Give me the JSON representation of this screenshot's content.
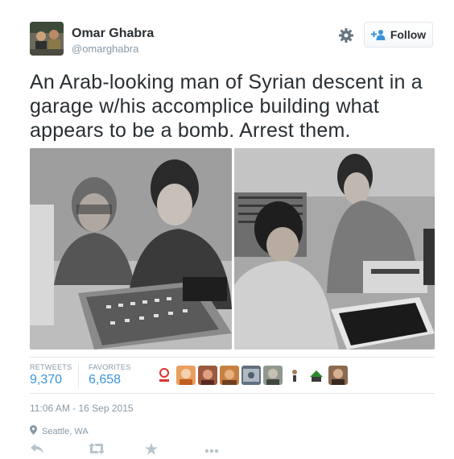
{
  "user": {
    "name": "Omar Ghabra",
    "handle": "@omarghabra"
  },
  "header": {
    "settings_icon": "gear-icon",
    "follow_label": "Follow",
    "follow_icon": "add-user-icon"
  },
  "tweet": {
    "text": "An Arab-looking man of Syrian descent in a garage w/his accomplice building what appears to be a bomb. Arrest them."
  },
  "stats": {
    "retweets_label": "RETWEETS",
    "retweets_value": "9,370",
    "favorites_label": "FAVORITES",
    "favorites_value": "6,658",
    "favoriters_count": 9
  },
  "meta": {
    "timestamp": "11:06 AM - 16 Sep 2015",
    "location": "Seattle, WA"
  },
  "actions": [
    "reply-icon",
    "retweet-icon",
    "favorite-icon",
    "more-icon"
  ],
  "colors": {
    "link": "#3b94d9",
    "muted": "#8899a6",
    "text": "#292f33",
    "border": "#e1e8ed"
  }
}
